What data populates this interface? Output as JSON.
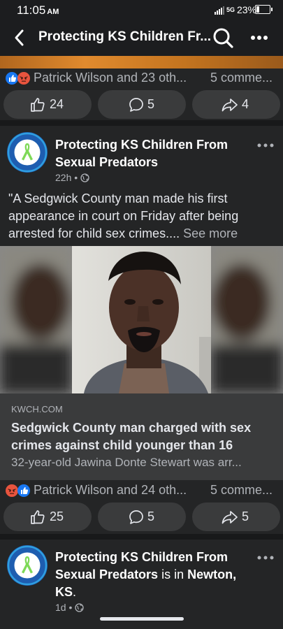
{
  "status_bar": {
    "time": "11:05",
    "ampm": "AM",
    "network": "5G",
    "battery": "23%",
    "battery_level": 0.23
  },
  "header": {
    "title": "Protecting KS Children Fr..."
  },
  "post1_footer": {
    "reactors": "Patrick Wilson and 23 oth...",
    "comments": "5 comme...",
    "like_count": "24",
    "comment_count": "5",
    "share_count": "4"
  },
  "post2": {
    "page_name": "Protecting KS Children From Sexual Predators",
    "time": "22h",
    "text": "\"A Sedgwick County man made his first appearance in court on Friday after being arrested for child sex crimes....",
    "see_more": "See more",
    "link": {
      "source": "KWCH.COM",
      "title": "Sedgwick County man charged with sex crimes against child younger than 16",
      "description": "32-year-old Jawina Donte Stewart was arr..."
    },
    "reactors": "Patrick Wilson and 24 oth...",
    "comments": "5 comme...",
    "like_count": "25",
    "comment_count": "5",
    "share_count": "5"
  },
  "post3": {
    "page_name": "Protecting KS Children From Sexual Predators",
    "is_in": "is in",
    "location": "Newton, KS",
    "time": "1d"
  },
  "colors": {
    "background": "#242526",
    "accent_like": "#1877f2",
    "angry": "#e8543e"
  }
}
